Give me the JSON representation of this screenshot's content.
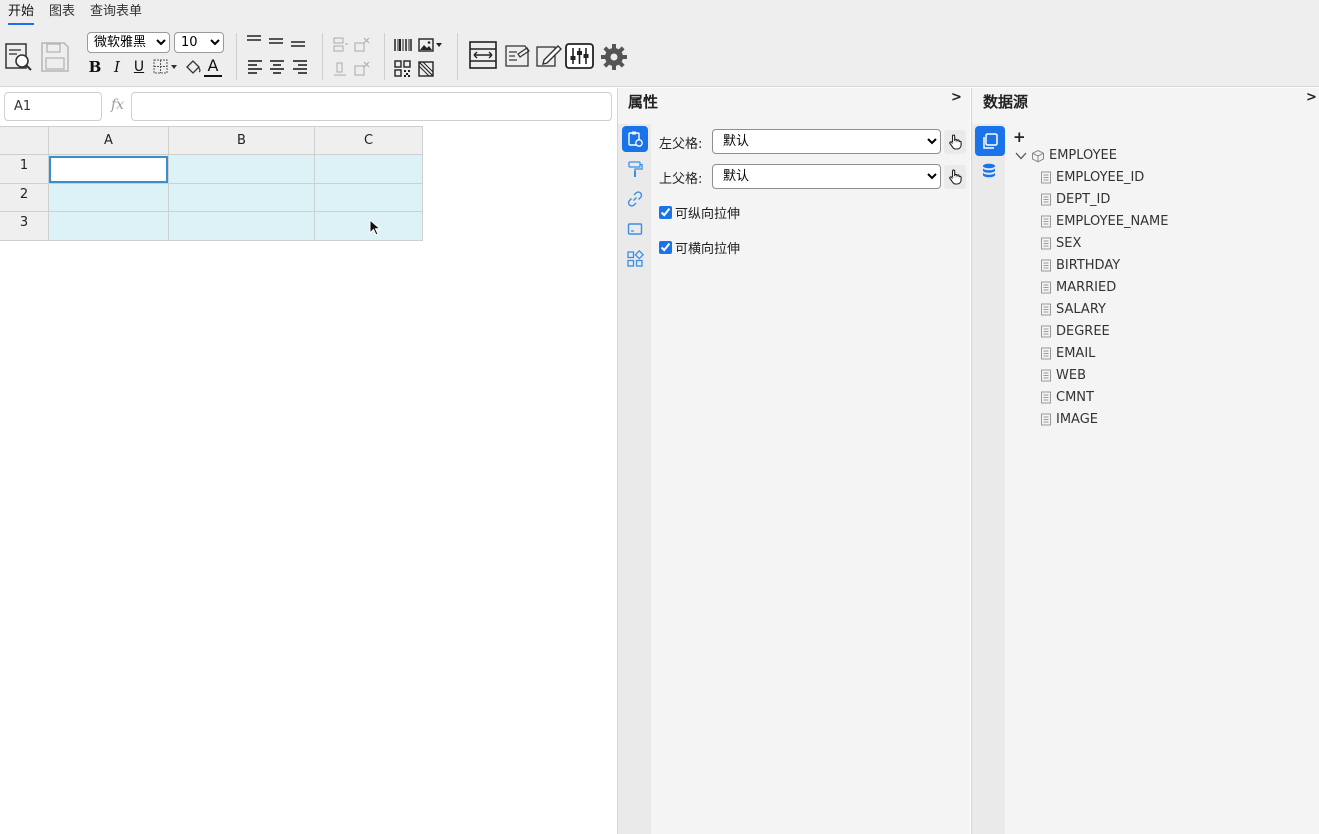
{
  "menu": {
    "tabs": [
      "开始",
      "图表",
      "查询表单"
    ]
  },
  "toolbar": {
    "font_family": "微软雅黑",
    "font_size": "10",
    "bold": "B",
    "italic": "I",
    "underline": "U",
    "font_color_label": "A"
  },
  "formula_bar": {
    "cell_ref": "A1",
    "fx_label": "fx",
    "formula": ""
  },
  "sheet": {
    "columns": [
      "A",
      "B",
      "C"
    ],
    "rows": [
      "1",
      "2",
      "3"
    ]
  },
  "properties": {
    "title": "属性",
    "collapse": ">",
    "left_parent_label": "左父格:",
    "left_parent_value": "默认",
    "top_parent_label": "上父格:",
    "top_parent_value": "默认",
    "vertical_stretch_label": "可纵向拉伸",
    "vertical_stretch_checked": true,
    "horizontal_stretch_label": "可横向拉伸",
    "horizontal_stretch_checked": true
  },
  "datasource": {
    "title": "数据源",
    "collapse": ">",
    "add_label": "+",
    "dataset": "EMPLOYEE",
    "fields": [
      "EMPLOYEE_ID",
      "DEPT_ID",
      "EMPLOYEE_NAME",
      "SEX",
      "BIRTHDAY",
      "MARRIED",
      "SALARY",
      "DEGREE",
      "EMAIL",
      "WEB",
      "CMNT",
      "IMAGE"
    ]
  },
  "colors": {
    "accent": "#1a73e8",
    "cell_fill": "#dcf2f7",
    "selected_border": "#3a8ec9"
  }
}
